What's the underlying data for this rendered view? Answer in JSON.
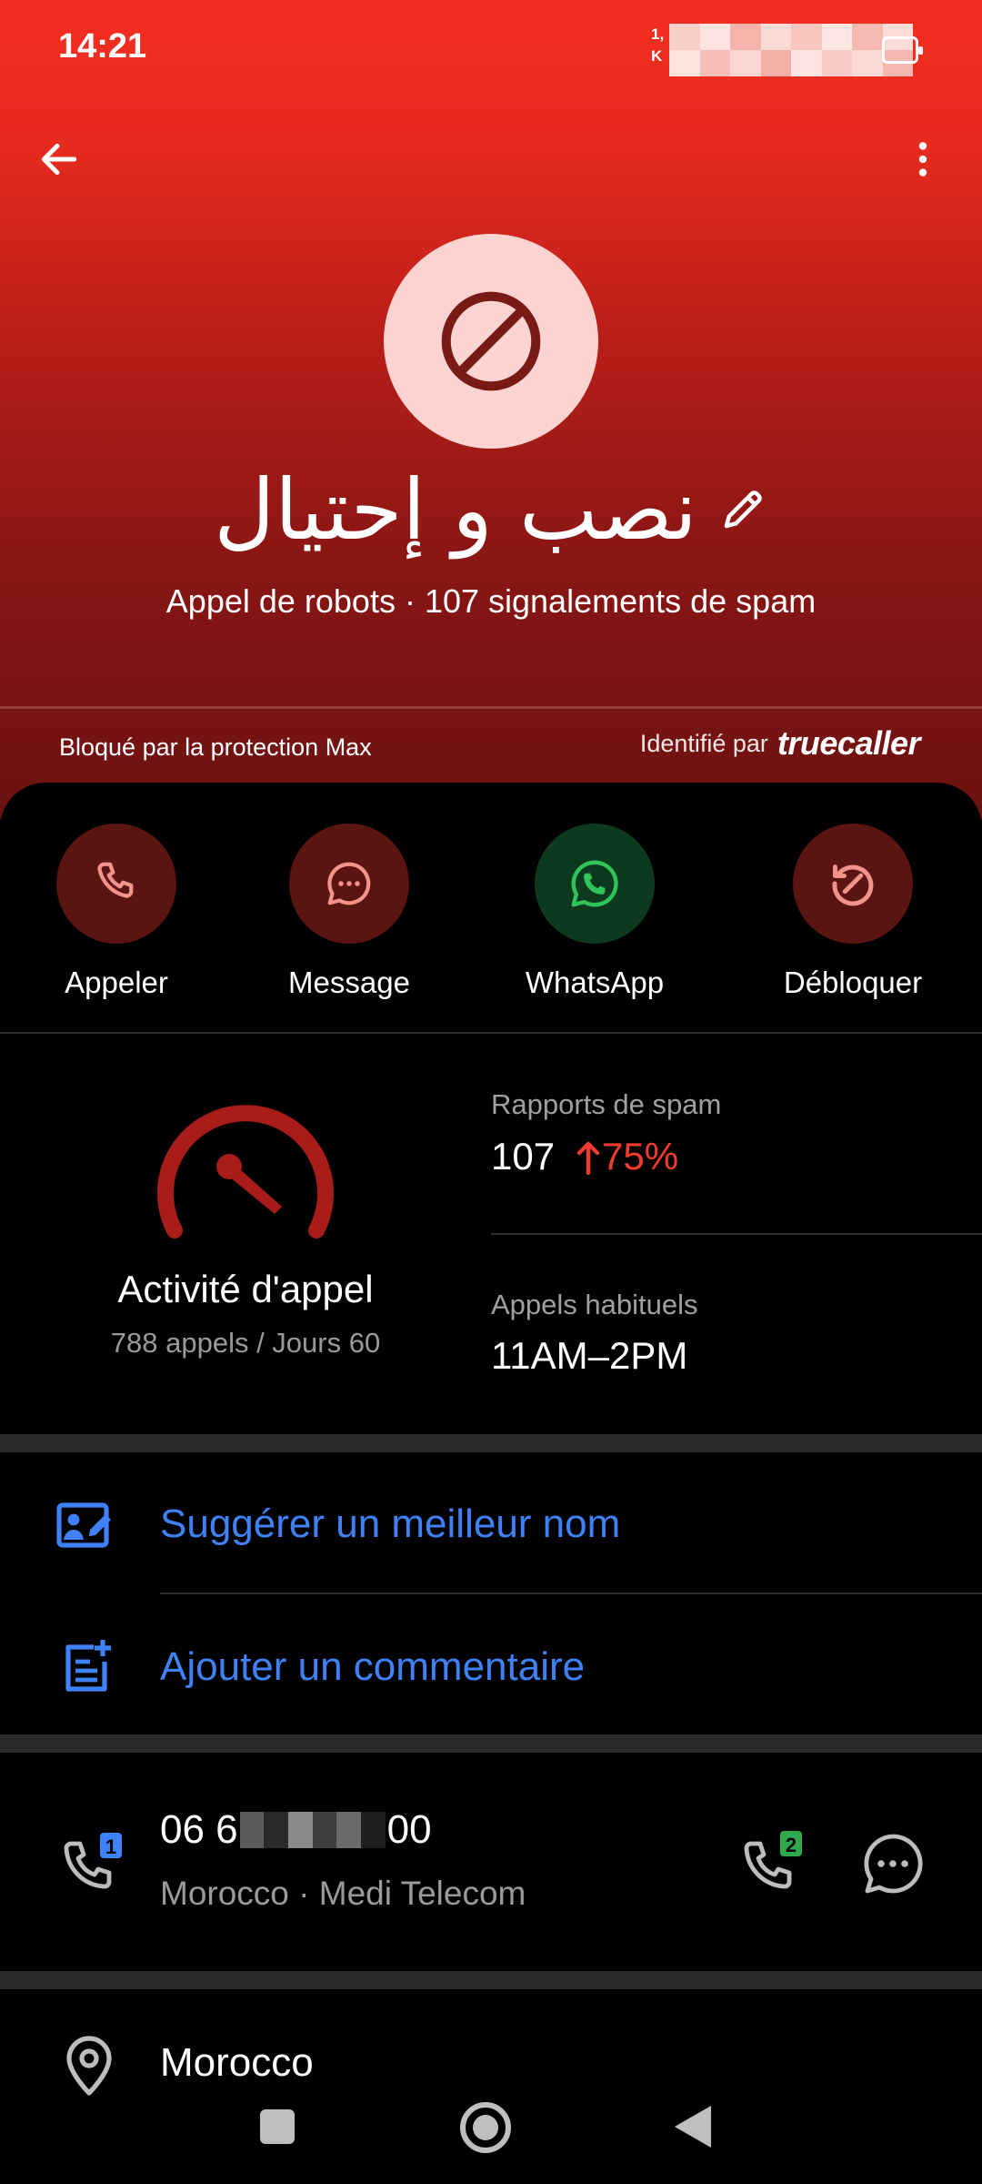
{
  "status_bar": {
    "time": "14:21",
    "small_text_line1": "1,",
    "small_text_line2": "K"
  },
  "header": {
    "back_icon": "arrow-left-icon",
    "more_icon": "more-vertical-icon"
  },
  "contact": {
    "avatar_icon": "block-icon",
    "name": "نصب و إحتيال",
    "edit_icon": "pencil-icon",
    "subtitle": "Appel de robots · 107 signalements de spam",
    "blocked_by": "Bloqué par la protection Max",
    "identified_by_label": "Identifié par",
    "identified_by_brand": "truecaller"
  },
  "actions": [
    {
      "label": "Appeler",
      "icon": "phone-icon",
      "color": "#5a1412",
      "icon_color": "#f0938a"
    },
    {
      "label": "Message",
      "icon": "chat-bubble-icon",
      "color": "#5a1412",
      "icon_color": "#f0938a"
    },
    {
      "label": "WhatsApp",
      "icon": "whatsapp-icon",
      "color": "#0d3a1e",
      "icon_color": "#2fc35a"
    },
    {
      "label": "Débloquer",
      "icon": "unblock-icon",
      "color": "#5a1412",
      "icon_color": "#f0938a"
    }
  ],
  "activity": {
    "title": "Activité d'appel",
    "subtitle": "788 appels / Jours 60",
    "gauge_icon": "speedometer-icon"
  },
  "stats": {
    "spam_label": "Rapports de spam",
    "spam_value": "107",
    "spam_change": "75%",
    "spam_change_icon": "arrow-up-icon",
    "usual_label": "Appels habituels",
    "usual_value": "11AM–2PM"
  },
  "links": {
    "suggest_label": "Suggérer un meilleur nom",
    "suggest_icon": "edit-card-icon",
    "comment_label": "Ajouter un commentaire",
    "comment_icon": "add-note-icon"
  },
  "number": {
    "prefix": "06 6",
    "suffix": "00",
    "meta": "Morocco · Medi Telecom",
    "sim1_badge": "1",
    "sim2_badge": "2"
  },
  "location": {
    "label": "Morocco",
    "icon": "location-pin-icon"
  },
  "colors": {
    "accent_blue": "#3f82f7",
    "spam_red": "#f23b30",
    "hero_top": "#f32e21",
    "hero_bottom": "#6a1211"
  }
}
